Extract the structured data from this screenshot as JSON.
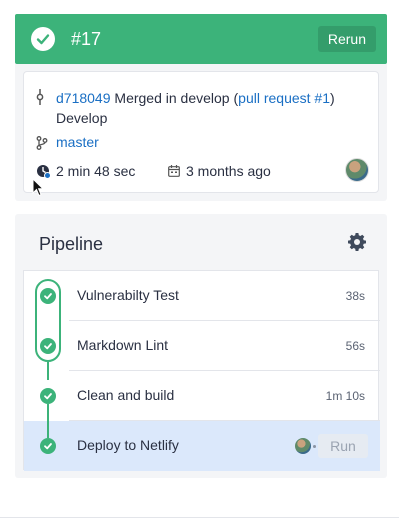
{
  "header": {
    "build_number": "#17",
    "rerun_label": "Rerun",
    "status_color": "#3cb37a"
  },
  "commit": {
    "sha": "d718049",
    "message_prefix": " Merged in develop (",
    "pr_link": "pull request #1",
    "message_suffix": ")",
    "message_line2": "Develop",
    "branch": "master",
    "duration": "2 min 48 sec",
    "time_ago": "3 months ago"
  },
  "pipeline": {
    "title": "Pipeline",
    "steps": [
      {
        "label": "Vulnerabilty Test",
        "time": "38s",
        "status": "success"
      },
      {
        "label": "Markdown Lint",
        "time": "56s",
        "status": "success"
      },
      {
        "label": "Clean and build",
        "time": "1m 10s",
        "status": "success"
      },
      {
        "label": "Deploy to Netlify",
        "time": "",
        "status": "success",
        "action": "Run"
      }
    ]
  },
  "icons": {
    "status": "check-circle-icon",
    "commit": "commit-icon",
    "branch": "branch-icon",
    "duration": "clock-icon",
    "date": "calendar-icon",
    "settings": "gear-icon"
  }
}
